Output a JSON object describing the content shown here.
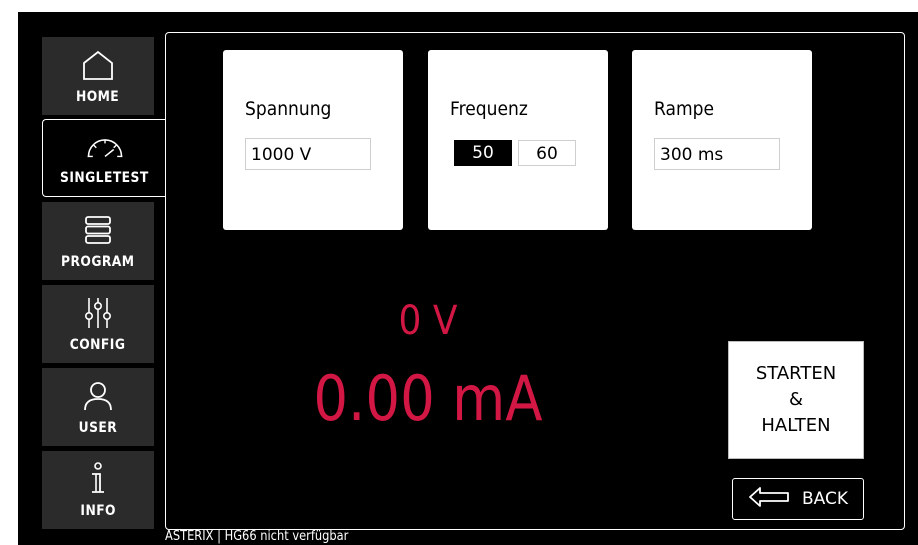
{
  "nav": {
    "home": "HOME",
    "singletest": "SINGLETEST",
    "program": "PROGRAM",
    "config": "CONFIG",
    "user": "USER",
    "info": "INFO",
    "active": "singletest"
  },
  "cards": {
    "spannung": {
      "title": "Spannung",
      "value": "1000 V"
    },
    "frequenz": {
      "title": "Frequenz",
      "options": [
        "50",
        "60"
      ],
      "selected": "50"
    },
    "rampe": {
      "title": "Rampe",
      "value": "300 ms"
    }
  },
  "readout": {
    "voltage": "0 V",
    "current": "0.00 mA",
    "color": "#d31744"
  },
  "actions": {
    "start_line1": "STARTEN",
    "start_line2": "&",
    "start_line3": "HALTEN",
    "back": "BACK"
  },
  "status": "ASTERIX | HG66 nicht verfügbar"
}
